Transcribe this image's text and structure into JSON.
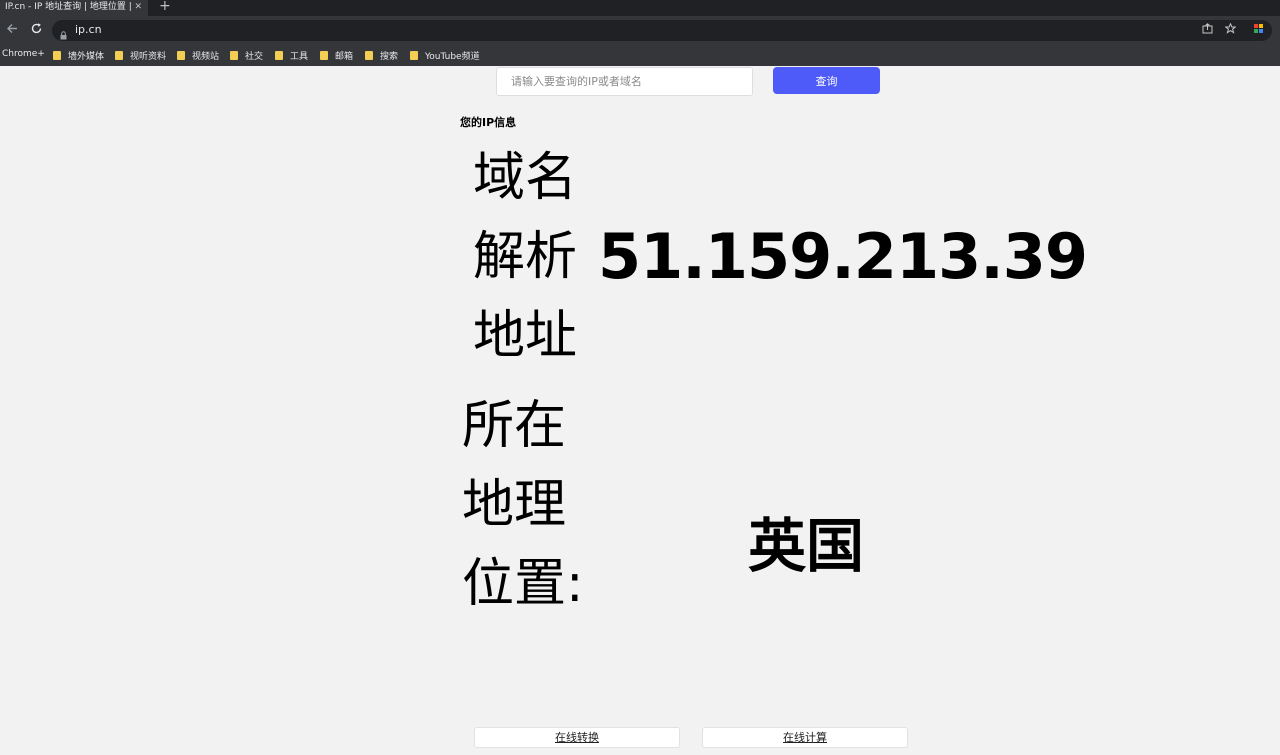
{
  "browser": {
    "tab_title": "IP.cn - IP 地址查询 | 地理位置 | 手",
    "tab_close": "✕",
    "new_tab": "+",
    "url": "ip.cn",
    "icons": [
      "back-arrow-icon",
      "reload-icon",
      "lock-icon",
      "share-icon",
      "star-icon",
      "extension-icon"
    ],
    "bookmarks": [
      {
        "label": "Chrome+",
        "folder": false
      },
      {
        "label": "墙外媒体",
        "folder": true
      },
      {
        "label": "视听资料",
        "folder": true
      },
      {
        "label": "视频站",
        "folder": true
      },
      {
        "label": "社交",
        "folder": true
      },
      {
        "label": "工具",
        "folder": true
      },
      {
        "label": "邮箱",
        "folder": true
      },
      {
        "label": "搜索",
        "folder": true
      },
      {
        "label": "YouTube频道",
        "folder": true
      }
    ]
  },
  "search": {
    "placeholder": "请输入要查询的IP或者域名",
    "button_label": "查询"
  },
  "info": {
    "title": "您的IP信息",
    "domain_label": "域名解析地址",
    "ip_value": "51.159.213.39",
    "location_label": "所在地理位置:",
    "location_value": "英国"
  },
  "links": {
    "convert_label": "在线转换",
    "calc_label": "在线计算"
  },
  "colors": {
    "tabstrip": "#202124",
    "toolbar": "#35363a",
    "page_bg": "#f2f2f2",
    "accent": "#4e5bf9"
  }
}
